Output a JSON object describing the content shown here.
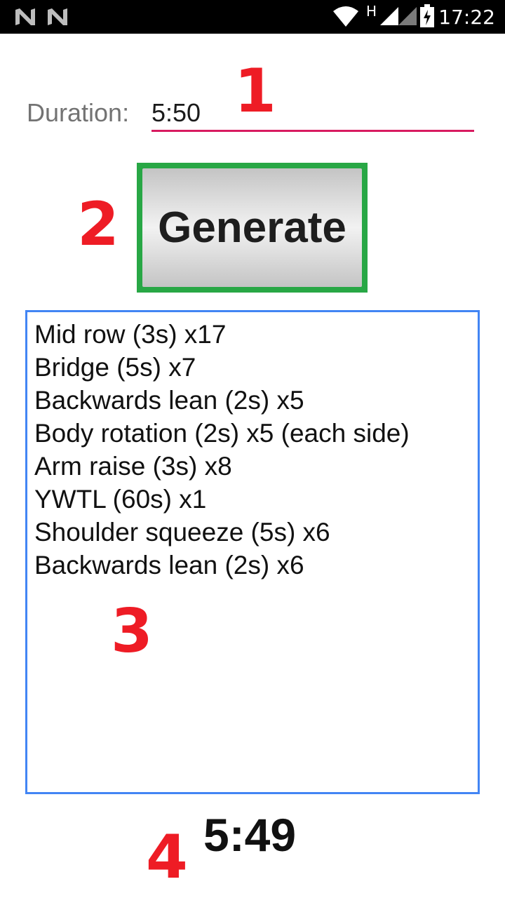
{
  "status_bar": {
    "time": "17:22",
    "network_indicator": "H",
    "icons": [
      "notification-n-icon",
      "notification-n-icon",
      "wifi-icon",
      "cell-signal-icon",
      "cell-signal-icon",
      "battery-charging-icon"
    ]
  },
  "form": {
    "duration_label": "Duration:",
    "duration_value": "5:50"
  },
  "generate_button": {
    "label": "Generate"
  },
  "exercises": [
    "Mid row (3s) x17",
    "Bridge (5s) x7",
    "Backwards lean (2s) x5",
    "Body rotation (2s) x5 (each side)",
    "Arm raise (3s) x8",
    "YWTL (60s) x1",
    "Shoulder squeeze (5s) x6",
    "Backwards lean (2s) x6"
  ],
  "timer": {
    "value": "5:49"
  },
  "annotations": {
    "marker_1": "1",
    "marker_2": "2",
    "marker_3": "3",
    "marker_4": "4",
    "color": "#ee1c25"
  },
  "colors": {
    "input_underline": "#d81b60",
    "button_outline": "#28a745",
    "list_border": "#4285f4"
  }
}
